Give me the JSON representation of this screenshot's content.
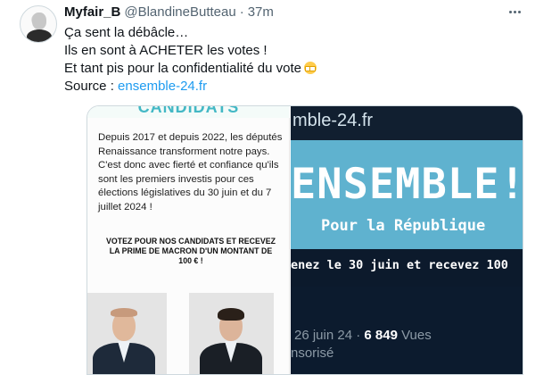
{
  "author": {
    "display_name": "Myfair_B",
    "handle": "@BlandineButteau",
    "separator": "·",
    "time": "37m"
  },
  "tweet": {
    "line1": "Ça sent la débâcle…",
    "line2": "Ils en sont à ACHETER les votes !",
    "line3": "Et tant pis pour la confidentialité du vote",
    "line3_emoji": "grimacing-face-emoji",
    "source_label": "Source :",
    "link_text": "ensemble-24.fr"
  },
  "media_left": {
    "header_partial": "CANDIDATS",
    "paragraph": "Depuis 2017 et depuis 2022, les députés Renaissance transforment notre pays. C'est donc avec fierté et confiance qu'ils sont les premiers investis pour ces élections législatives du 30 juin et du 7 juillet 2024 !",
    "vote_line1": "VOTEZ POUR NOS CANDIDATS ET RECEVEZ",
    "vote_line2": "LA PRIME DE MACRON D'UN MONTANT DE",
    "vote_line3": "100 € !"
  },
  "media_right": {
    "url_text": "mble-24.fr",
    "title": "ENSEMBLE!",
    "subtitle": "Pour la République",
    "offer": "enez le 30 juin et recevez 100",
    "date_text": "26 juin 24 ·",
    "views_count": "6 849",
    "views_label": "Vues",
    "sponsored_partial": "nsorisé"
  },
  "colors": {
    "link": "#1d9bf0",
    "banner": "#5fb2cf",
    "dark_panel": "#0c1b2e"
  }
}
